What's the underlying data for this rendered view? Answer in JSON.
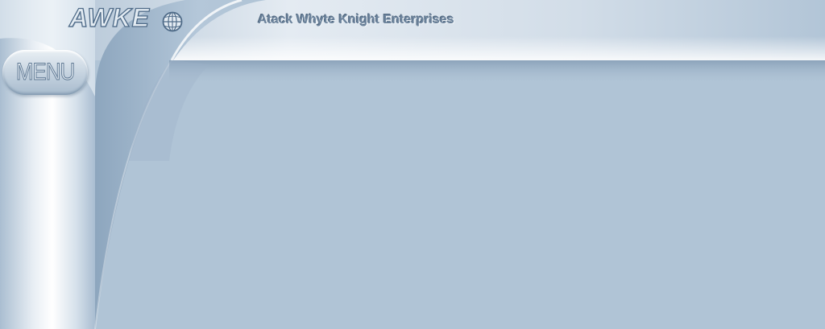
{
  "logo": {
    "text": "AWKE",
    "icon": "globe-icon"
  },
  "header": {
    "title": "Atack Whyte Knight Enterprises"
  },
  "nav": {
    "menu_label": "MENU"
  },
  "colors": {
    "background": "#b0c4d6",
    "header_highlight": "#ffffff",
    "title_text": "#6d849d",
    "logo_outline": "#4f6b88"
  }
}
